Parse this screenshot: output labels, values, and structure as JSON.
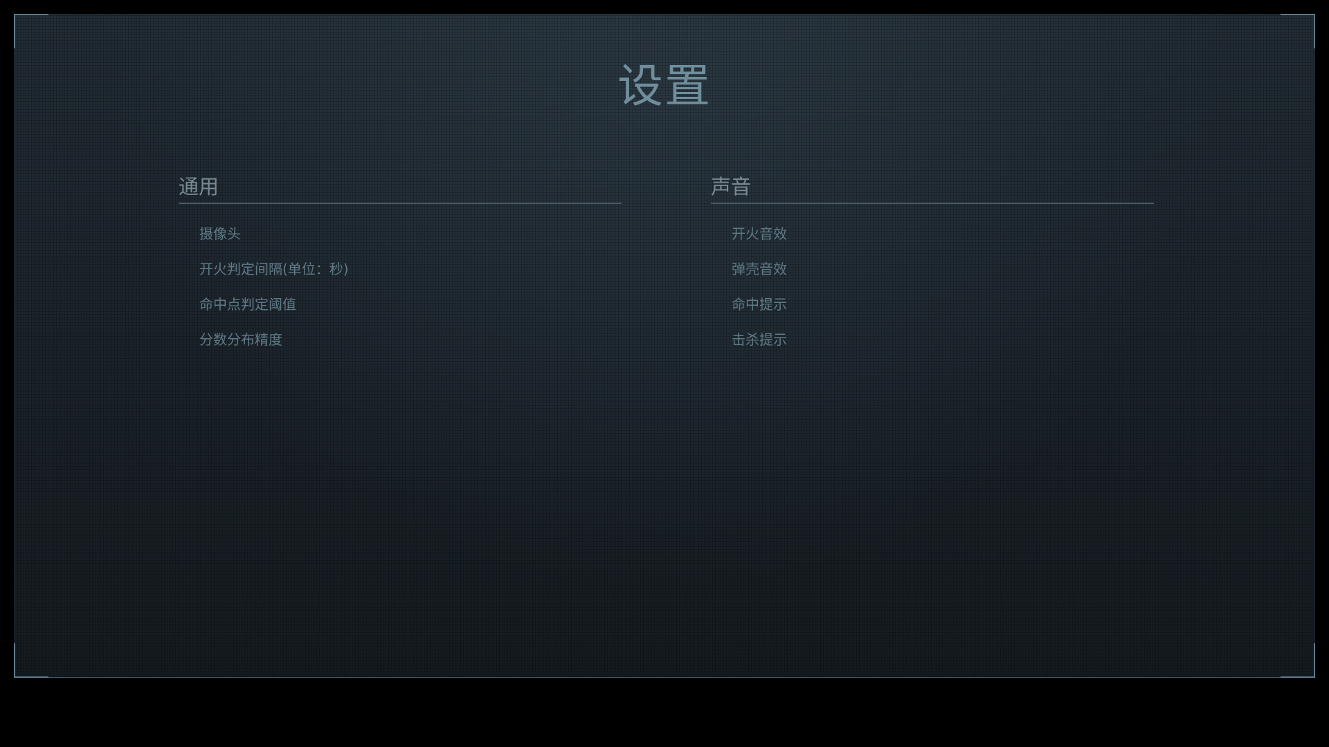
{
  "page": {
    "title": "设置"
  },
  "sections": {
    "general": {
      "header": "通用",
      "items": [
        "摄像头",
        "开火判定间隔(单位：秒)",
        "命中点判定阈值",
        "分数分布精度"
      ]
    },
    "sound": {
      "header": "声音",
      "items": [
        "开火音效",
        "弹壳音效",
        "命中提示",
        "击杀提示"
      ]
    }
  },
  "colors": {
    "background": "#000000",
    "panel": "#1b242b",
    "accent": "#5d7b8c",
    "title": "#6f8e9c",
    "header": "#7a8a92",
    "item": "#5f7a86"
  }
}
